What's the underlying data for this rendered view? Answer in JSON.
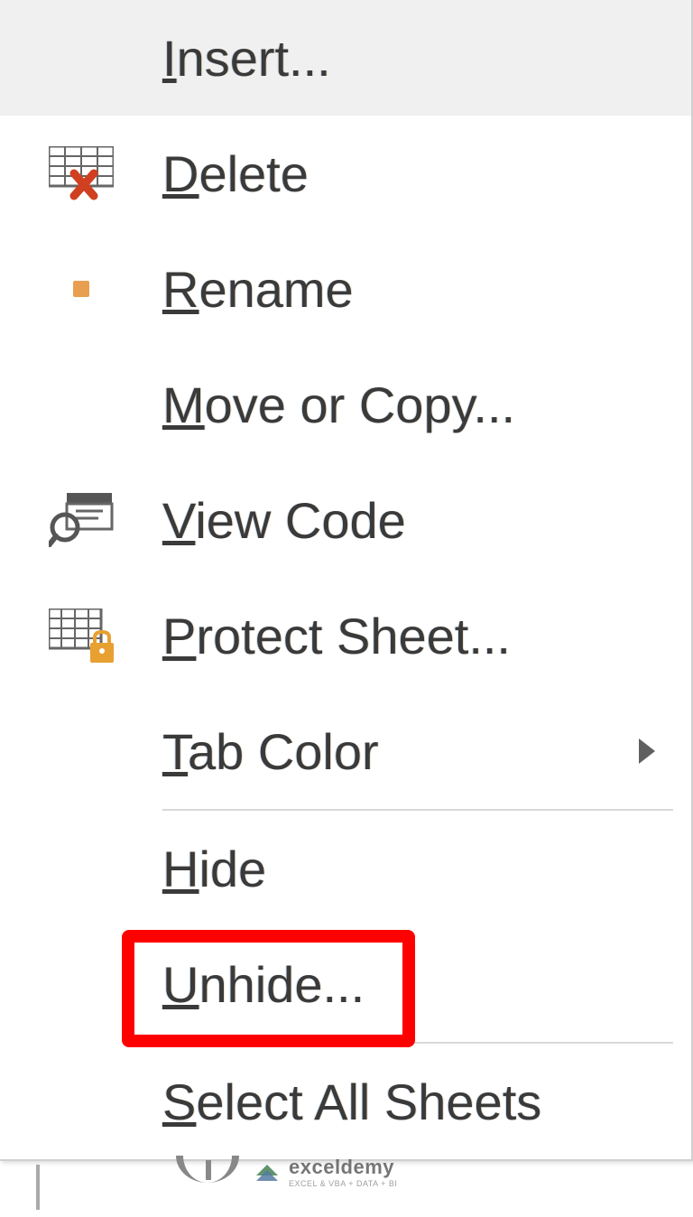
{
  "menu": {
    "items": [
      {
        "label": "Insert...",
        "accelerator": "I",
        "icon": null
      },
      {
        "label": "Delete",
        "accelerator": "D",
        "icon": "delete-grid"
      },
      {
        "label": "Rename",
        "accelerator": "R",
        "icon": "rename-dot"
      },
      {
        "label": "Move or Copy...",
        "accelerator": "M",
        "icon": null
      },
      {
        "label": "View Code",
        "accelerator": "V",
        "icon": "view-code"
      },
      {
        "label": "Protect Sheet...",
        "accelerator": "P",
        "icon": "protect-sheet"
      },
      {
        "label": "Tab Color",
        "accelerator": "T",
        "icon": null,
        "submenu": true
      },
      {
        "label": "Hide",
        "accelerator": "H",
        "icon": null
      },
      {
        "label": "Unhide...",
        "accelerator": "U",
        "icon": null,
        "highlighted": true
      },
      {
        "label": "Select All Sheets",
        "accelerator": "S",
        "icon": null
      }
    ]
  },
  "watermark": {
    "brand": "exceldemy",
    "tagline": "EXCEL & VBA + DATA + BI"
  }
}
